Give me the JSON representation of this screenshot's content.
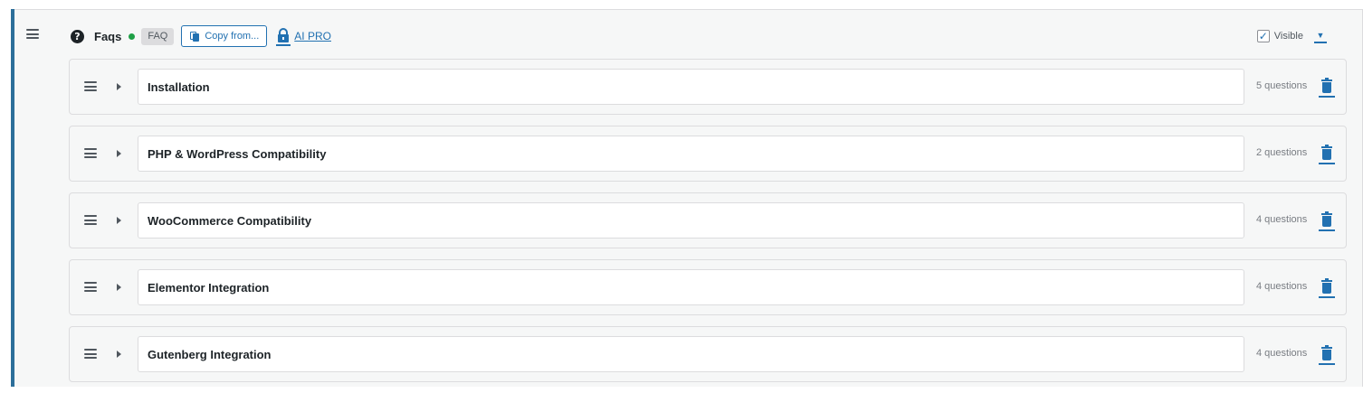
{
  "section": {
    "title": "Faqs",
    "badge": "FAQ",
    "copy_button": "Copy from...",
    "ai_pro_label": "AI PRO",
    "visible_label": "Visible",
    "visible_checked": true,
    "status_color": "#1fa046",
    "accent_color": "#2271b1",
    "icons": {
      "help": "help-icon",
      "copy": "copy-icon",
      "lock": "lock-icon",
      "handle": "drag-handle-icon",
      "expand": "caret-right-icon",
      "delete": "trash-icon",
      "dropdown": "caret-down-icon"
    }
  },
  "faqs": [
    {
      "title": "Installation",
      "count": "5 questions"
    },
    {
      "title": "PHP & WordPress Compatibility",
      "count": "2 questions"
    },
    {
      "title": "WooCommerce Compatibility",
      "count": "4 questions"
    },
    {
      "title": "Elementor Integration",
      "count": "4 questions"
    },
    {
      "title": "Gutenberg Integration",
      "count": "4 questions"
    }
  ]
}
